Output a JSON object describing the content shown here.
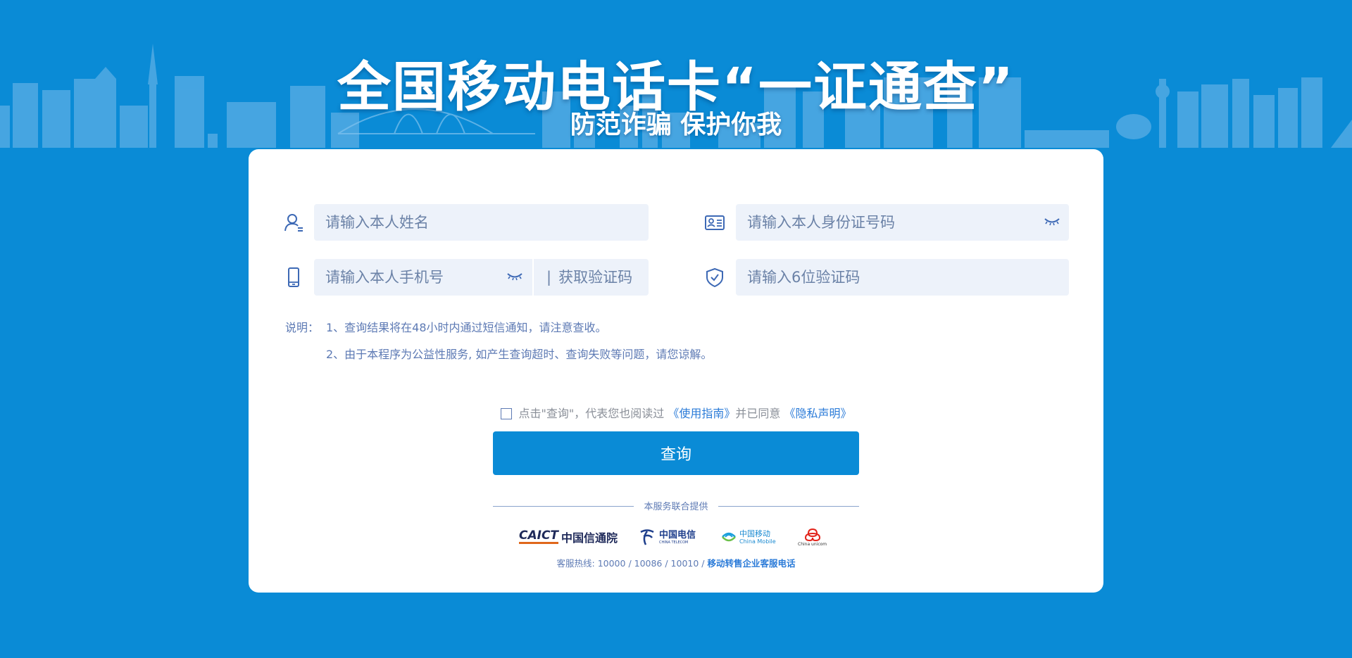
{
  "header": {
    "title": "全国移动电话卡“一证通查”",
    "subtitle": "防范诈骗 保护你我"
  },
  "form": {
    "name_placeholder": "请输入本人姓名",
    "id_placeholder": "请输入本人身份证号码",
    "phone_placeholder": "请输入本人手机号",
    "get_code_separator": "|",
    "get_code_label": "获取验证码",
    "code_placeholder": "请输入6位验证码"
  },
  "notes": {
    "label": "说明：",
    "line1": "1、查询结果将在48小时内通过短信通知，请注意查收。",
    "line2": "2、由于本程序为公益性服务, 如产生查询超时、查询失败等问题，请您谅解。"
  },
  "agreement": {
    "prefix": "点击\"查询\"，代表您也阅读过",
    "guide_link": "《使用指南》",
    "middle": "并已同意",
    "privacy_link": "《隐私声明》"
  },
  "submit_label": "查询",
  "providers": {
    "caption": "本服务联合提供",
    "caict_mark": "CAICT",
    "caict_name": "中国信通院",
    "telecom_cn": "中国电信",
    "telecom_en": "CHINA TELECOM",
    "mobile_cn": "中国移动",
    "mobile_en": "China Mobile",
    "unicom_en": "China unicom"
  },
  "hotline": {
    "text": "客服热线: 10000 / 10086 / 10010 / ",
    "link": "移动转售企业客服电话"
  },
  "colors": {
    "brand_blue": "#0a8bd6",
    "input_bg": "#edf2fa",
    "note_text": "#5d7ab4",
    "link": "#2b7bd8"
  },
  "icons": [
    "user-icon",
    "id-card-icon",
    "eye-closed-icon",
    "mobile-phone-icon",
    "shield-check-icon",
    "checkbox-icon"
  ]
}
